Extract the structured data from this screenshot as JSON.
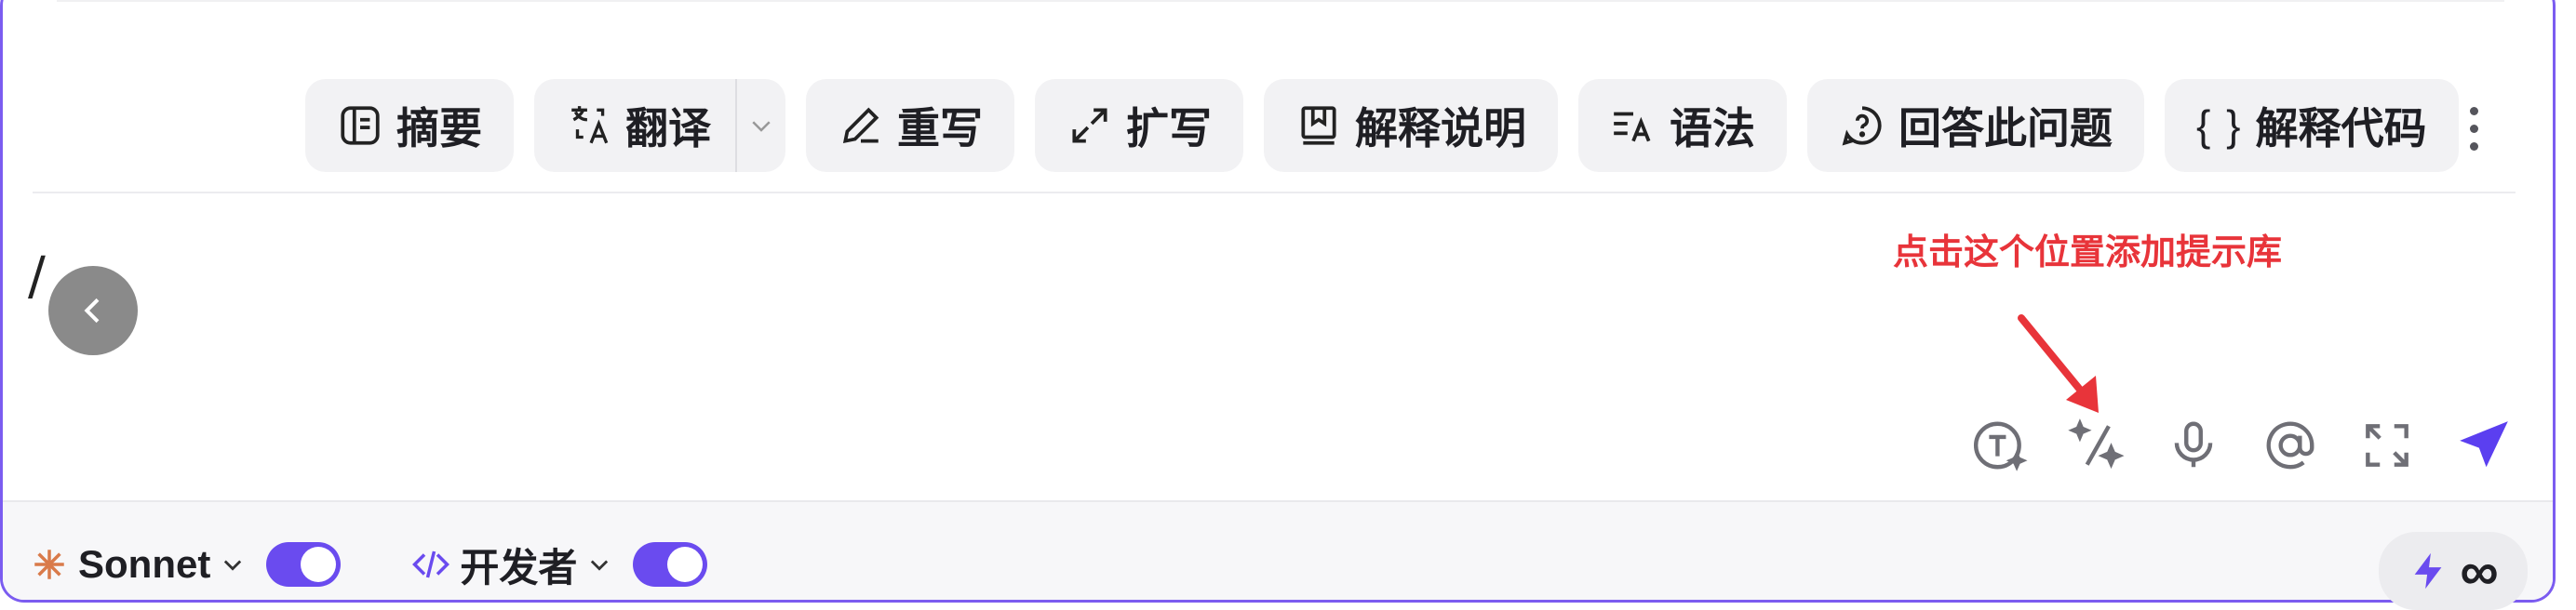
{
  "toolbar": {
    "items": [
      {
        "label": "摘要",
        "icon": "summary-icon"
      },
      {
        "label": "翻译",
        "icon": "translate-icon"
      },
      {
        "label": "重写",
        "icon": "pencil-icon"
      },
      {
        "label": "扩写",
        "icon": "expand-arrows-icon"
      },
      {
        "label": "解释说明",
        "icon": "book-icon"
      },
      {
        "label": "语法",
        "icon": "grammar-icon"
      },
      {
        "label": "回答此问题",
        "icon": "question-circle-icon"
      },
      {
        "label": "解释代码",
        "icon": "braces-icon",
        "prefix": "{ }"
      }
    ]
  },
  "editor": {
    "text": "/"
  },
  "annotation": {
    "text": "点击这个位置添加提示库"
  },
  "input_icons": [
    "text-tool-icon",
    "prompt-library-icon",
    "microphone-icon",
    "mention-icon",
    "fullscreen-icon",
    "send-icon"
  ],
  "bottom": {
    "model": "Sonnet",
    "mode": "开发者",
    "credits": "∞"
  },
  "colors": {
    "accent": "#6a4bef",
    "annotation": "#e8343a",
    "border": "#7b5cf0"
  }
}
